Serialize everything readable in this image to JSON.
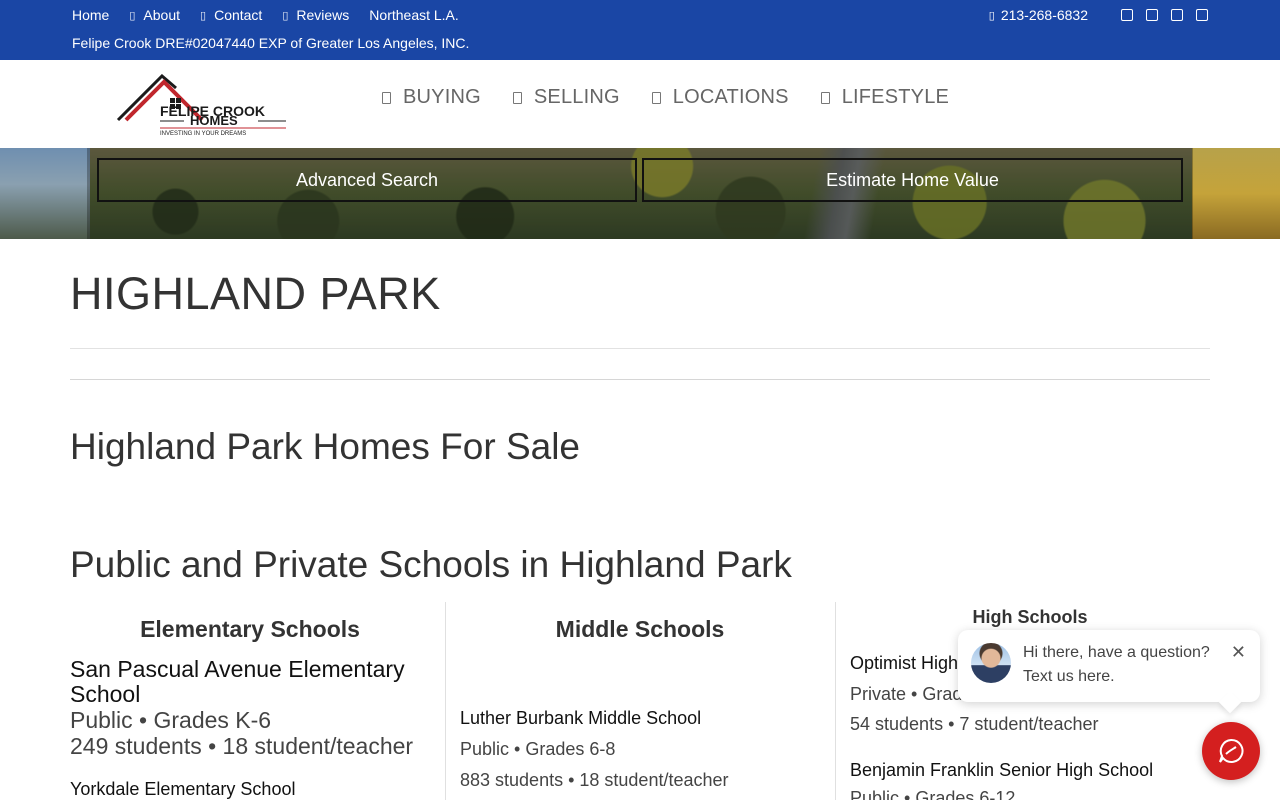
{
  "topbar": {
    "nav": [
      {
        "label": "Home",
        "icon": ""
      },
      {
        "label": "About",
        "icon": "user-icon"
      },
      {
        "label": "Contact",
        "icon": "envelope-icon"
      },
      {
        "label": "Reviews",
        "icon": "star-icon"
      },
      {
        "label": "Northeast L.A.",
        "icon": ""
      }
    ],
    "license": "Felipe Crook DRE#02047440 EXP of Greater Los Angeles, INC.",
    "phone": "213-268-6832",
    "social_icons": [
      "facebook-icon",
      "instagram-icon",
      "linkedin-icon",
      "youtube-icon"
    ],
    "color": "#1a46a5"
  },
  "logo": {
    "line1": "FELIPE CROOK",
    "line2": "HOMES",
    "tagline": "INVESTING IN YOUR DREAMS"
  },
  "mainnav": [
    {
      "label": "BUYING"
    },
    {
      "label": "SELLING"
    },
    {
      "label": "LOCATIONS"
    },
    {
      "label": "LIFESTYLE"
    }
  ],
  "hero": {
    "advanced_search": "Advanced Search",
    "estimate_home_value": "Estimate Home Value"
  },
  "page": {
    "title": "HIGHLAND PARK",
    "homes_heading": "Highland Park Homes For Sale",
    "schools_heading": "Public and Private Schools in Highland Park"
  },
  "schools": {
    "elementary": {
      "heading": "Elementary Schools",
      "items": [
        {
          "name": "San Pascual Avenue Elementary School",
          "type": "Public • Grades K-6",
          "stats": "249 students • 18 student/teacher"
        },
        {
          "name": "Yorkdale Elementary School"
        }
      ]
    },
    "middle": {
      "heading": "Middle Schools",
      "items": [
        {
          "name": "Luther Burbank Middle School",
          "type": "Public • Grades 6-8",
          "stats": "883 students • 18 student/teacher"
        }
      ]
    },
    "high": {
      "heading": "High Schools",
      "items": [
        {
          "name": "Optimist High",
          "type": "Private • Grad",
          "stats": "54 students • 7 student/teacher"
        },
        {
          "name": "Benjamin Franklin Senior High School",
          "type": "Public • Grades 6-12"
        }
      ]
    }
  },
  "chat": {
    "line1": "Hi there, have a question?",
    "line2": "Text us here.",
    "close": "✕",
    "accent": "#d41f1f"
  }
}
